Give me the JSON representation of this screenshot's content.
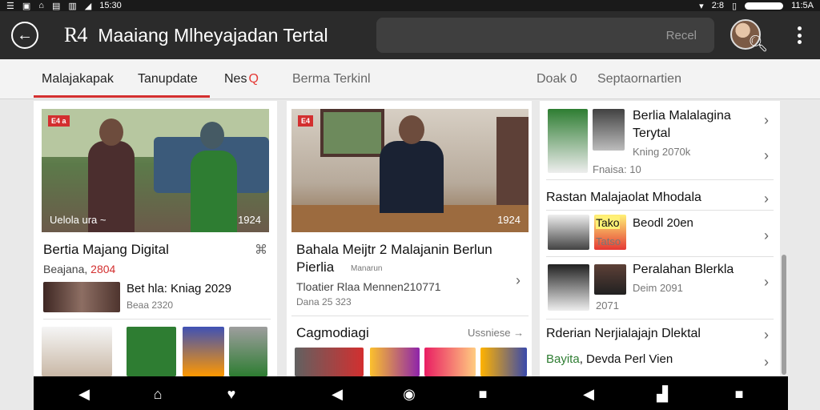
{
  "status": {
    "left_text": "15:30",
    "right_text_1": "2:8",
    "right_text_2": "11:5A"
  },
  "appbar": {
    "logo": "R4",
    "title": "Maaiang Mlheyajadan Tertal",
    "search_placeholder": "Recel"
  },
  "tabs": [
    {
      "label": "Malajakapak"
    },
    {
      "label": "Tanupdate"
    },
    {
      "label": "Nes",
      "badge": "Q"
    },
    {
      "label": "Berma Terkinl"
    },
    {
      "label": "Doak 0"
    },
    {
      "label": "Septaornartien"
    }
  ],
  "col1": {
    "card": {
      "badge": "E4 a",
      "img_caption": "Uelola  ura ~",
      "img_num": "1924",
      "title": "Bertia Majang Digital",
      "sub_prefix": "Beajana, ",
      "sub_red": "2804"
    },
    "item": {
      "title": "Bet hla: Kniag 2029",
      "date": "Beaa 2320"
    }
  },
  "col2": {
    "card": {
      "badge": "E4",
      "img_num": "1924",
      "title_line1": "Bahala Meijtr 2 Malajanin Berlun",
      "title_line2": "Pierlia",
      "red_note": "Manarun",
      "meta1": "Tloatier Rlaa Mennen210771",
      "meta2": "Dana 25  323"
    },
    "section": {
      "title": "Cagmodiagi",
      "more": "Ussniese →"
    }
  },
  "col3": {
    "list": [
      {
        "title_line1": "Berlia Malalagina",
        "title_line2": "Terytal",
        "meta1": "Kning 2070k",
        "meta2": "Fnaisa: 10"
      },
      {
        "title": "Rastan Malajaolat Mhodala"
      },
      {
        "tag": "Tako",
        "title": "Beodl 20en",
        "meta": "Tatso"
      },
      {
        "title": "Peralahan Blerkla",
        "meta1": "Deim 2091",
        "meta2": "2071"
      },
      {
        "title": "Rderian Nerjialajajn Dlektal"
      },
      {
        "title_green": "Bayita",
        "title_rest": ", Devda Perl Vien"
      }
    ]
  },
  "nav": {
    "icons": [
      "back-triangle-icon",
      "home-icon",
      "heart-icon",
      "back-triangle-icon",
      "home-circle-icon",
      "recents-square-icon",
      "back-triangle-icon",
      "apps-icon",
      "recents-square-icon"
    ]
  }
}
